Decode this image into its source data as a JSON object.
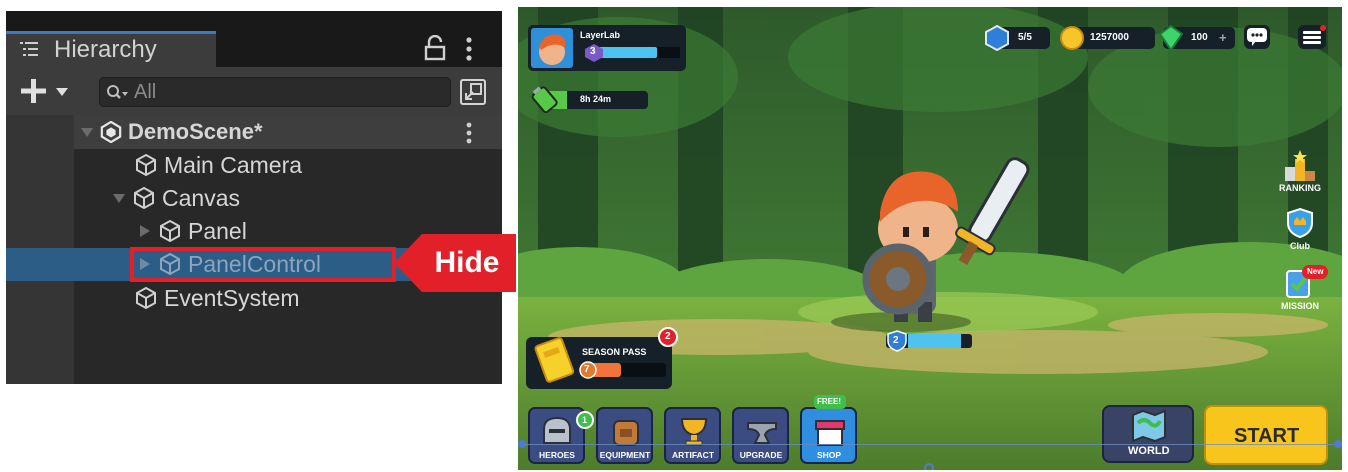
{
  "hierarchy": {
    "tab_label": "Hierarchy",
    "search_placeholder": "All",
    "rows": [
      {
        "label": "DemoScene*"
      },
      {
        "label": "Main Camera"
      },
      {
        "label": "Canvas"
      },
      {
        "label": "Panel"
      },
      {
        "label": "PanelControl"
      },
      {
        "label": "EventSystem"
      }
    ],
    "callout_label": "Hide"
  },
  "game": {
    "player_name": "LayerLab",
    "player_level": "3",
    "energy_timer": "8h 24m",
    "currency": {
      "keys": "5/5",
      "gold": "1257000",
      "gems": "100",
      "gems_plus": "+"
    },
    "side_menu": {
      "ranking": "RANKING",
      "club": "Club",
      "mission": "MISSION",
      "mission_badge": "New"
    },
    "hero_level": "2",
    "season_pass": {
      "title": "SEASON PASS",
      "level": "7",
      "badge": "2"
    },
    "nav": {
      "heroes": "HEROES",
      "heroes_badge": "1",
      "equipment": "EQUIPMENT",
      "artifact": "ARTIFACT",
      "upgrade": "UPGRADE",
      "shop": "SHOP",
      "shop_badge": "FREE!"
    },
    "world_label": "WORLD",
    "start_label": "START",
    "colors": {
      "start_button": "#f7c51c",
      "selection_outline": "#e2202a",
      "unity_selection": "#2c5d87"
    }
  }
}
